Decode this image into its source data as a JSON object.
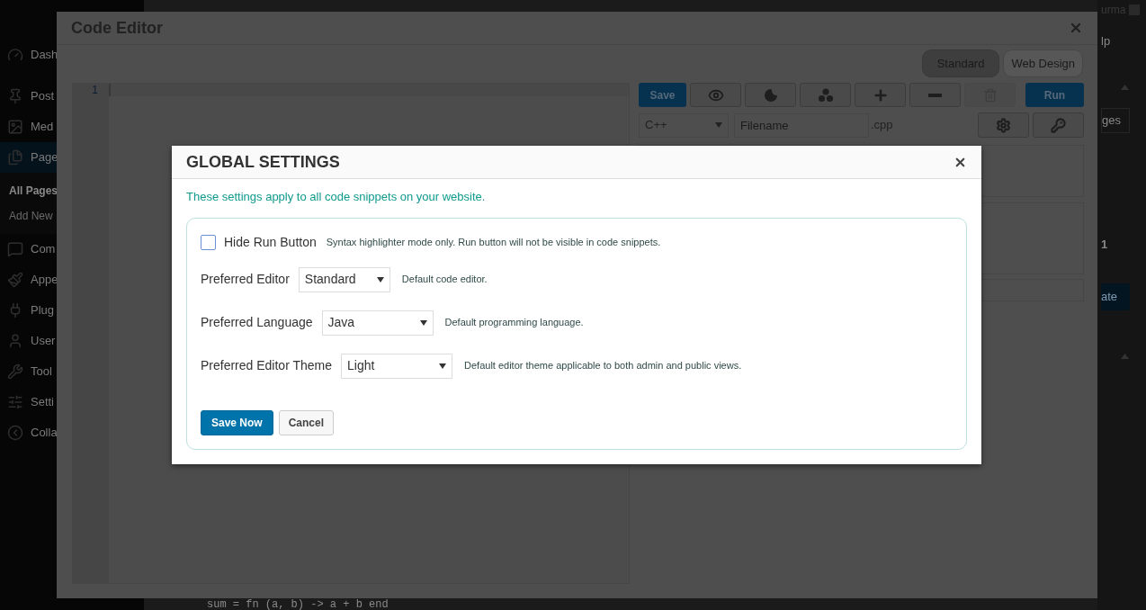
{
  "admin_sidebar": {
    "items": [
      {
        "label": "Dash",
        "selected": false
      },
      {
        "label": "Post",
        "selected": false
      },
      {
        "label": "Med",
        "selected": false
      },
      {
        "label": "Page",
        "selected": true,
        "submenu": [
          {
            "label": "All Pages",
            "selected": true
          },
          {
            "label": "Add New",
            "selected": false
          }
        ]
      },
      {
        "label": "Com",
        "selected": false
      },
      {
        "label": "Appe",
        "selected": false
      },
      {
        "label": "Plug",
        "selected": false
      },
      {
        "label": "User",
        "selected": false
      },
      {
        "label": "Tool",
        "selected": false
      },
      {
        "label": "Setti",
        "selected": false
      },
      {
        "label": "Colla",
        "selected": false
      }
    ]
  },
  "admin_right": {
    "user_name": "urma",
    "help_tab": "lp",
    "screen_button": "ges",
    "count": "1",
    "update_button": "ate"
  },
  "background_code_line": "sum = fn (a, b) -> a + b end",
  "code_editor": {
    "title": "Code Editor",
    "mode_buttons": [
      {
        "label": "Standard",
        "selected": true
      },
      {
        "label": "Web Design",
        "selected": false
      }
    ],
    "save_button": "Save",
    "run_button": "Run",
    "delete_disabled": true,
    "language": "C++",
    "filename_placeholder": "Filename",
    "extension": ".cpp",
    "line_numbers": [
      "1"
    ]
  },
  "global_settings": {
    "title": "GLOBAL SETTINGS",
    "description": "These settings apply to all code snippets on your website.",
    "hide_run": {
      "label": "Hide Run Button",
      "hint": "Syntax highlighter mode only. Run button will not be visible in code snippets.",
      "checked": false
    },
    "selects": [
      {
        "label": "Preferred Editor",
        "value": "Standard",
        "hint": "Default code editor."
      },
      {
        "label": "Preferred Language",
        "value": "Java",
        "hint": "Default programming language."
      },
      {
        "label": "Preferred Editor Theme",
        "value": "Light",
        "hint": "Default editor theme applicable to both admin and public views."
      }
    ],
    "save_button": "Save Now",
    "cancel_button": "Cancel"
  }
}
